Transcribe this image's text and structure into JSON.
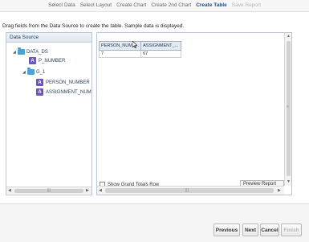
{
  "wizard_steps": [
    {
      "label": "Select Data",
      "state": "normal"
    },
    {
      "label": "Select Layout",
      "state": "normal"
    },
    {
      "label": "Create Chart",
      "state": "normal"
    },
    {
      "label": "Create 2nd Chart",
      "state": "normal"
    },
    {
      "label": "Create Table",
      "state": "active"
    },
    {
      "label": "Save Report",
      "state": "disabled"
    }
  ],
  "instruction": "Drag fields from the Data Source to create the table. Sample data is displayed.",
  "data_source": {
    "title": "Data Source",
    "tree": {
      "root": "DATA_DS",
      "field": "P_NUMBER",
      "group": "G_1",
      "group_fields": [
        "PERSON_NUMBER",
        "ASSIGNMENT_NUM"
      ]
    }
  },
  "table": {
    "headers": [
      "PERSON_NUMB...",
      "ASSIGNMENT_..."
    ],
    "rows": [
      [
        "7",
        "67"
      ]
    ]
  },
  "options": {
    "show_grand_totals": "Show Grand Totals Row",
    "preview_report": "Preview Report"
  },
  "scrollbar_glyphs": {
    "left": "◀",
    "right": "▶",
    "up": "▲",
    "down": "▼",
    "grip": "|||",
    "grip_v": "≡"
  },
  "footer": {
    "previous": "Previous",
    "next": "Next",
    "cancel": "Cancel",
    "finish": "Finish"
  },
  "colors": {
    "active_step": "#1f4f87",
    "attribute_badge": "#6c56b7",
    "folder": "#4aa1d6"
  }
}
